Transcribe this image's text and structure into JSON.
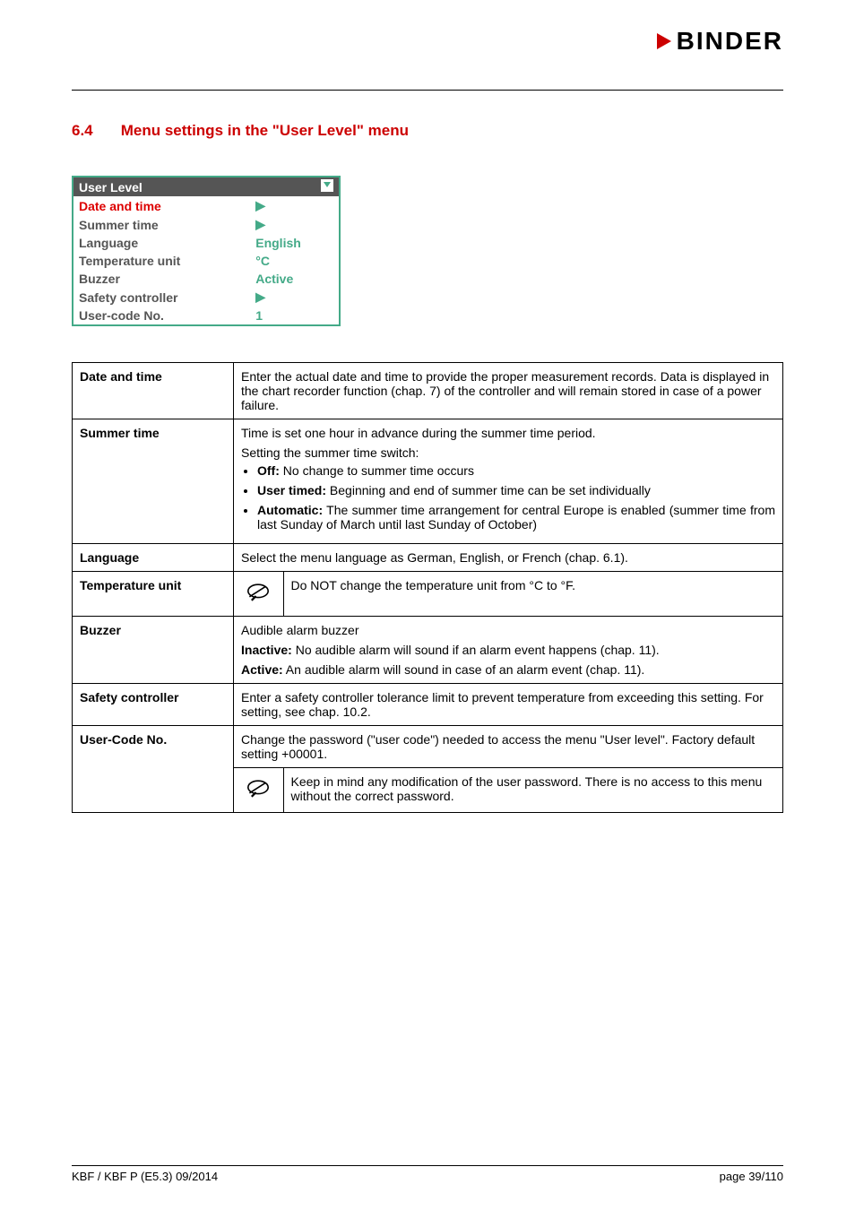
{
  "brand": "BINDER",
  "section": {
    "num": "6.4",
    "title": "Menu settings in the \"User Level\" menu"
  },
  "menu": {
    "title": "User Level",
    "rows": [
      {
        "label": "Date and time",
        "value": "▶",
        "vclass": "green-right",
        "sel": true
      },
      {
        "label": "Summer time",
        "value": "▶",
        "vclass": "black-right"
      },
      {
        "label": "Language",
        "value": "English"
      },
      {
        "label": "Temperature unit",
        "value": "°C"
      },
      {
        "label": "Buzzer",
        "value": "Active"
      },
      {
        "label": "Safety controller",
        "value": "▶",
        "vclass": "black-right"
      },
      {
        "label": "User-code No.",
        "value": "1"
      }
    ]
  },
  "defs": {
    "date_and_time": {
      "label": "Date and time",
      "text": "Enter the actual date and time to provide the proper measurement records. Data is displayed in the chart recorder function (chap. 7) of the controller and will remain stored in case of a power failure."
    },
    "summer_time": {
      "label": "Summer time",
      "intro1": "Time is set one hour in advance during the summer time period.",
      "intro2": "Setting the summer time switch:",
      "items": [
        {
          "b": "Off:",
          "t": " No change to summer time occurs"
        },
        {
          "b": "User timed:",
          "t": " Beginning and end of summer time can be set individually"
        },
        {
          "b": "Automatic:",
          "t": " The summer time arrangement for central Europe is enabled (summer time from last Sunday of March until last Sunday of October)"
        }
      ]
    },
    "language": {
      "label": "Language",
      "text": "Select the menu language as German, English, or French (chap. 6.1)."
    },
    "temp_unit": {
      "label": "Temperature unit",
      "note": "Do NOT change the temperature unit from °C to °F."
    },
    "buzzer": {
      "label": "Buzzer",
      "l1": "Audible alarm buzzer",
      "l2b": "Inactive:",
      "l2t": " No audible alarm will sound if an alarm event happens (chap. 11).",
      "l3b": "Active:",
      "l3t": " An audible alarm will sound in case of an alarm event (chap. 11)."
    },
    "safety": {
      "label": "Safety controller",
      "text": "Enter a safety controller tolerance limit to prevent temperature from exceeding this setting. For setting, see chap. 10.2."
    },
    "usercode": {
      "label": "User-Code No.",
      "text": "Change the password (\"user code\") needed to access the menu \"User level\". Factory default setting +00001.",
      "note": "Keep in mind any modification of the user password. There is no access to this menu without the correct password."
    }
  },
  "footer": {
    "left": "KBF / KBF P (E5.3) 09/2014",
    "right": "page 39/110"
  }
}
